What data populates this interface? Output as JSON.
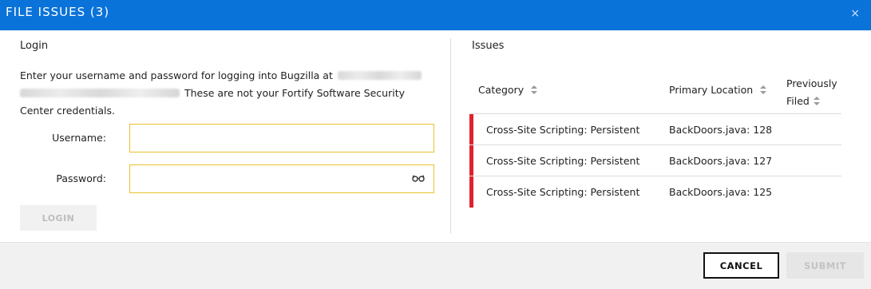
{
  "dialog": {
    "title": "FILE ISSUES (3)",
    "close_glyph": "×"
  },
  "login": {
    "heading": "Login",
    "intro_part1": "Enter your username and password for logging into Bugzilla at",
    "intro_part2": "These are not your Fortify Software Security Center credentials.",
    "username_label": "Username:",
    "username_value": "",
    "password_label": "Password:",
    "password_value": "",
    "reveal_icon": "glasses-icon",
    "reveal_glyph": "👓",
    "login_button": "LOGIN"
  },
  "issues": {
    "heading": "Issues",
    "columns": {
      "category": "Category",
      "primary_location": "Primary Location",
      "previously_line1": "Previously",
      "previously_line2": "Filed"
    },
    "sort_glyph": "⇕",
    "rows": [
      {
        "category": "Cross-Site Scripting: Persistent",
        "location": "BackDoors.java: 128",
        "previously_filed": ""
      },
      {
        "category": "Cross-Site Scripting: Persistent",
        "location": "BackDoors.java: 127",
        "previously_filed": ""
      },
      {
        "category": "Cross-Site Scripting: Persistent",
        "location": "BackDoors.java: 125",
        "previously_filed": ""
      }
    ],
    "severity_color": "#e0212f"
  },
  "footer": {
    "cancel_button": "CANCEL",
    "submit_button": "SUBMIT"
  },
  "colors": {
    "titlebar": "#0a73d9",
    "field_border": "#e8c12a"
  }
}
